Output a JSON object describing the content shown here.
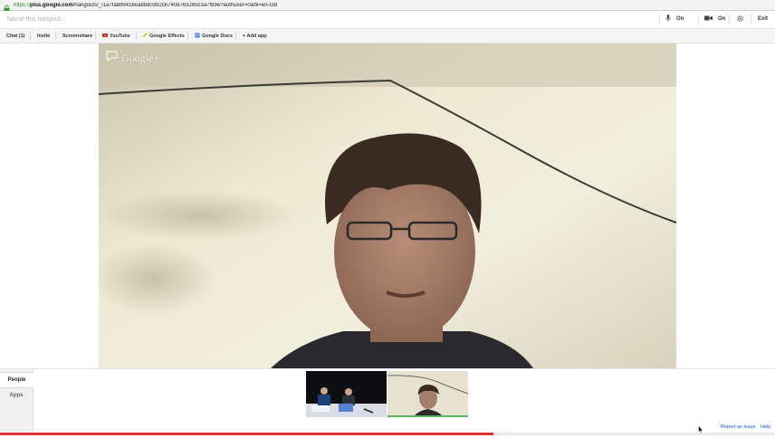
{
  "browser": {
    "url_scheme": "https://",
    "url_host": "plus.google.com",
    "url_path": "/hangouts/_/1a7fab89418eabb80392c6740d763265c3a7f89e?authuser=0&hl=en-GB"
  },
  "hangout": {
    "name_placeholder": "Name this hangout...",
    "controls": {
      "mic_label": "On",
      "camera_label": "On",
      "exit_label": "Exit"
    }
  },
  "apps": {
    "tabs": [
      {
        "label": "Chat (1)"
      },
      {
        "label": "Invite"
      },
      {
        "label": "Screenshare"
      },
      {
        "label": "YouTube"
      },
      {
        "label": "Google Effects"
      },
      {
        "label": "Google Docs"
      },
      {
        "label": "+ Add app"
      }
    ]
  },
  "video": {
    "watermark": "Google+"
  },
  "side_panel": {
    "tabs": [
      {
        "label": "People",
        "active": true
      },
      {
        "label": "Apps",
        "active": false
      }
    ]
  },
  "footer": {
    "report_label": "Report an issue",
    "help_label": "Help"
  },
  "colors": {
    "accent_green": "#5cb85c",
    "progress_red": "#dd3333",
    "link_blue": "#1155cc"
  },
  "icons": [
    "lock-icon",
    "mic-icon",
    "camera-icon",
    "gear-icon",
    "youtube-icon",
    "effects-icon",
    "docs-icon",
    "google-plus-chat-icon",
    "mouse-cursor-icon"
  ]
}
